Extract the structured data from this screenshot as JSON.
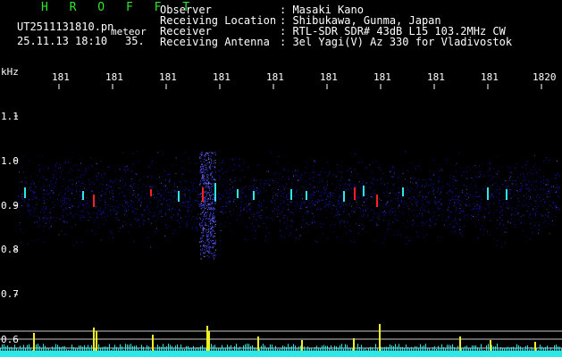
{
  "app": {
    "title": "H R O F F T",
    "filename": "UT2511131810.pn",
    "datetime": "25.11.13 18:10",
    "counter": "35.",
    "meteor_tag": "meteor"
  },
  "observer_info": [
    {
      "label": "Observer",
      "value": ": Masaki Kano"
    },
    {
      "label": "Receiving Location",
      "value": ": Shibukawa, Gunma, Japan"
    },
    {
      "label": "Receiver",
      "value": ": RTL-SDR SDR# 43dB L15 103.2MHz CW"
    },
    {
      "label": "Receiving Antenna",
      "value": ": 3el Yagi(V) Az 330 for Vladivostok"
    }
  ],
  "axis": {
    "unit": "kHz",
    "x_ticks": [
      "181",
      "181",
      "181",
      "181",
      "181",
      "181",
      "181",
      "181",
      "181",
      "1820"
    ],
    "y_ticks": [
      "1.1",
      "1.0",
      "0.9",
      "0.8",
      "0.7",
      "0.6"
    ]
  },
  "colors": {
    "background": "#000000",
    "text": "#ffffff",
    "title": "#2ee82e",
    "noise": "#1a1aff",
    "signal_red": "#ff2020",
    "signal_cyan": "#2ee8e8",
    "signal_yellow": "#f0f020",
    "grid": "#c8c8c8"
  }
}
